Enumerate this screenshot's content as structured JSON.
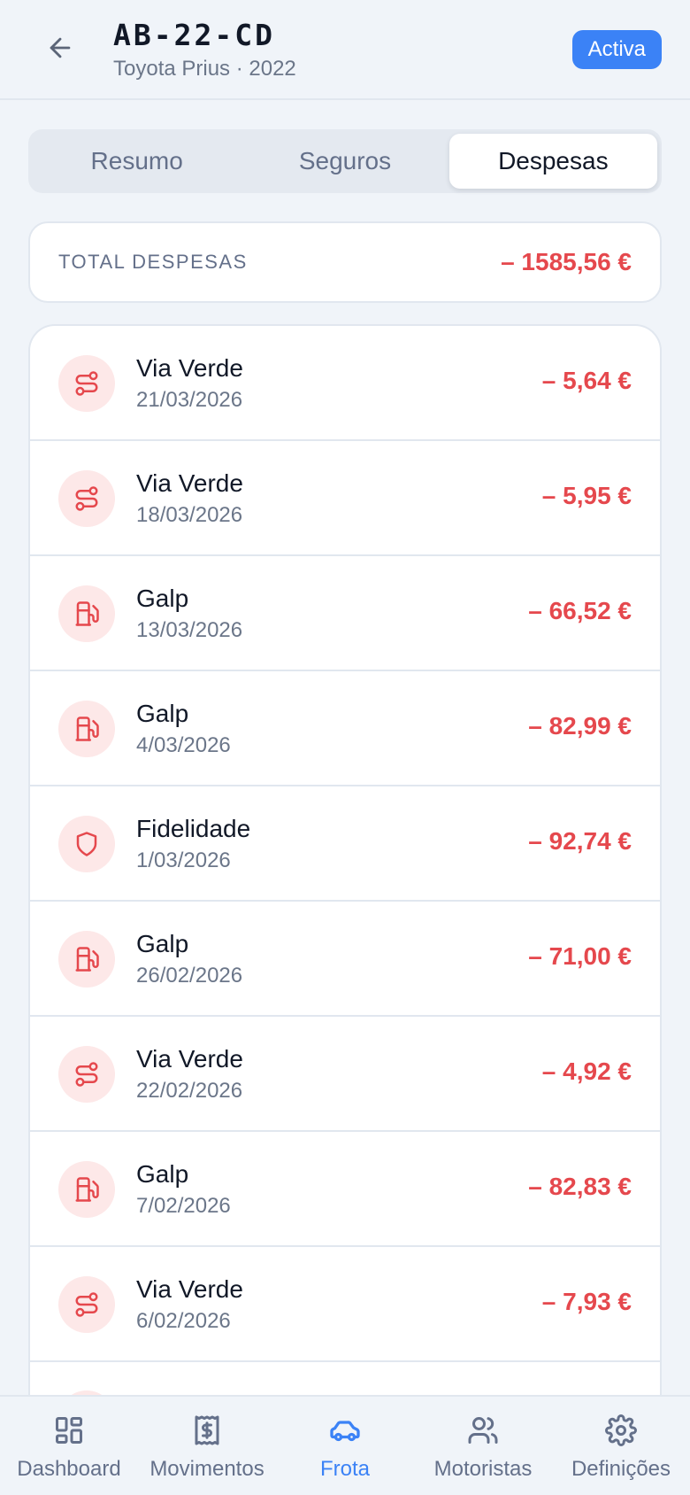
{
  "header": {
    "plate": "AB-22-CD",
    "model": "Toyota Prius · 2022",
    "status": "Activa"
  },
  "tabs": [
    {
      "label": "Resumo",
      "active": false
    },
    {
      "label": "Seguros",
      "active": false
    },
    {
      "label": "Despesas",
      "active": true
    }
  ],
  "total": {
    "label": "TOTAL DESPESAS",
    "value": "– 1585,56 €"
  },
  "expenses": [
    {
      "title": "Via Verde",
      "date": "21/03/2026",
      "amount": "– 5,64 €",
      "icon": "route-icon"
    },
    {
      "title": "Via Verde",
      "date": "18/03/2026",
      "amount": "– 5,95 €",
      "icon": "route-icon"
    },
    {
      "title": "Galp",
      "date": "13/03/2026",
      "amount": "– 66,52 €",
      "icon": "fuel-icon"
    },
    {
      "title": "Galp",
      "date": "4/03/2026",
      "amount": "– 82,99 €",
      "icon": "fuel-icon"
    },
    {
      "title": "Fidelidade",
      "date": "1/03/2026",
      "amount": "– 92,74 €",
      "icon": "shield-icon"
    },
    {
      "title": "Galp",
      "date": "26/02/2026",
      "amount": "– 71,00 €",
      "icon": "fuel-icon"
    },
    {
      "title": "Via Verde",
      "date": "22/02/2026",
      "amount": "– 4,92 €",
      "icon": "route-icon"
    },
    {
      "title": "Galp",
      "date": "7/02/2026",
      "amount": "– 82,83 €",
      "icon": "fuel-icon"
    },
    {
      "title": "Via Verde",
      "date": "6/02/2026",
      "amount": "– 7,93 €",
      "icon": "route-icon"
    }
  ],
  "nav": [
    {
      "label": "Dashboard",
      "icon": "dashboard-icon",
      "active": false
    },
    {
      "label": "Movimentos",
      "icon": "receipt-icon",
      "active": false
    },
    {
      "label": "Frota",
      "icon": "car-icon",
      "active": true
    },
    {
      "label": "Motoristas",
      "icon": "users-icon",
      "active": false
    },
    {
      "label": "Definições",
      "icon": "gear-icon",
      "active": false
    }
  ],
  "colors": {
    "accent": "#3b82f6",
    "expense": "#e5484d",
    "icon_bg": "#fde8e8",
    "background": "#f0f4f9"
  }
}
